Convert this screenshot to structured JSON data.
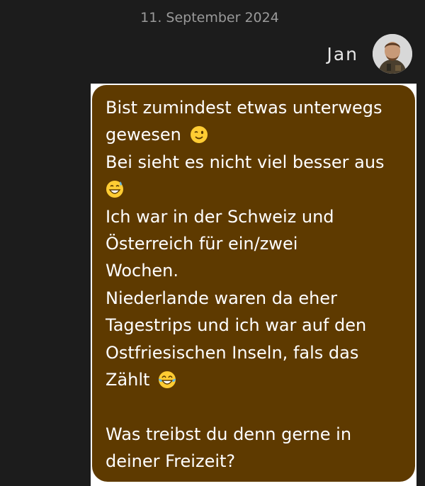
{
  "conversation": {
    "date": "11. September 2024",
    "sender": {
      "name": "Jan",
      "avatar_icon": "profile-photo"
    },
    "message": {
      "bubble_color": "#5e3a00",
      "lines": {
        "l1": "Bist zumindest etwas unterwegs",
        "l2": "gewesen",
        "l3": "Bei sieht es nicht viel besser aus",
        "l5": "Ich war in der Schweiz und",
        "l6": "Österreich für ein/zwei",
        "l7": "Wochen.",
        "l8": "Niederlande waren da eher",
        "l9": "Tagestrips und ich war auf den",
        "l10": "Ostfriesischen Inseln, fals das",
        "l11": "Zählt",
        "l13": "Was treibst du denn gerne in",
        "l14": "deiner Freizeit?"
      },
      "emojis": [
        "winking-face",
        "grinning-face-with-sweat",
        "face-with-tears-of-joy"
      ]
    }
  }
}
